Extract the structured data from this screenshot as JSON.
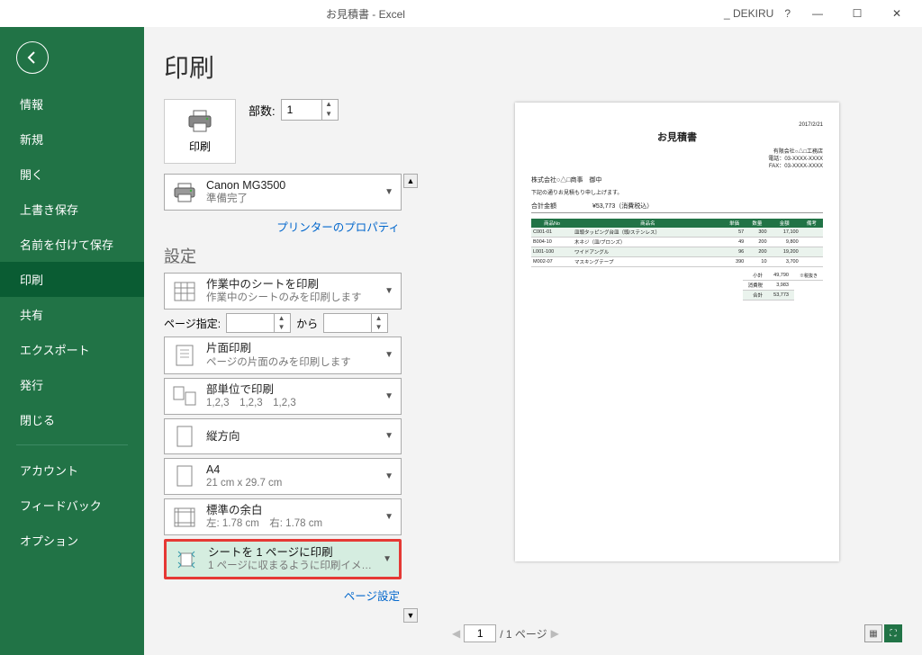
{
  "titlebar": {
    "title": "お見積書 - Excel",
    "user": "_ DEKIRU",
    "help": "?"
  },
  "sidebar": {
    "items": [
      "情報",
      "新規",
      "開く",
      "上書き保存",
      "名前を付けて保存",
      "印刷",
      "共有",
      "エクスポート",
      "発行",
      "閉じる"
    ],
    "bottom": [
      "アカウント",
      "フィードバック",
      "オプション"
    ],
    "active_index": 5
  },
  "page": {
    "heading": "印刷",
    "print_button": "印刷",
    "copies_label": "部数:",
    "copies_value": "1"
  },
  "printer": {
    "name": "Canon MG3500",
    "status": "準備完了",
    "props_link": "プリンターのプロパティ"
  },
  "settings": {
    "heading": "設定",
    "items": [
      {
        "t1": "作業中のシートを印刷",
        "t2": "作業中のシートのみを印刷します"
      },
      {
        "t1": "片面印刷",
        "t2": "ページの片面のみを印刷します"
      },
      {
        "t1": "部単位で印刷",
        "t2": "1,2,3　1,2,3　1,2,3"
      },
      {
        "t1": "縦方向",
        "t2": ""
      },
      {
        "t1": "A4",
        "t2": "21 cm x 29.7 cm"
      },
      {
        "t1": "標準の余白",
        "t2": "左: 1.78 cm　右: 1.78 cm"
      },
      {
        "t1": "シートを 1 ページに印刷",
        "t2": "1 ページに収まるように印刷イメ…"
      }
    ],
    "page_range_label": "ページ指定:",
    "page_range_to": "から",
    "page_setup_link": "ページ設定"
  },
  "preview": {
    "current_page": "1",
    "total_label": "/ 1 ページ",
    "prev": "◀",
    "next": "▶"
  },
  "doc": {
    "date": "2017/2/21",
    "title": "お見積書",
    "company": [
      "有限会社○△□工務店",
      "電話：03-XXXX-XXXX",
      "FAX：03-XXXX-XXXX"
    ],
    "client": "株式会社○△□商事　御中",
    "note": "下記の通りお見積もり申し上げます。",
    "total_label": "合計金額",
    "total_value": "¥53,773（消費税込）",
    "headers": [
      "商品No",
      "商品名",
      "単価",
      "数量",
      "金額",
      "備考"
    ],
    "rows": [
      [
        "C001-01",
        "皿頭タッピング台皿（頭/ステンレス）",
        "57",
        "300",
        "17,100",
        ""
      ],
      [
        "B004-10",
        "木ネジ（皿/ブロンズ）",
        "49",
        "200",
        "9,800",
        ""
      ],
      [
        "L001-100",
        "ワイドアングル",
        "96",
        "200",
        "19,200",
        ""
      ],
      [
        "M002-07",
        "マスキングテープ",
        "390",
        "10",
        "3,700",
        ""
      ]
    ],
    "summary": [
      [
        "小計",
        "49,790"
      ],
      [
        "消費税",
        "3,983"
      ],
      [
        "合計",
        "53,773"
      ]
    ],
    "summary_note": "※税抜き"
  }
}
